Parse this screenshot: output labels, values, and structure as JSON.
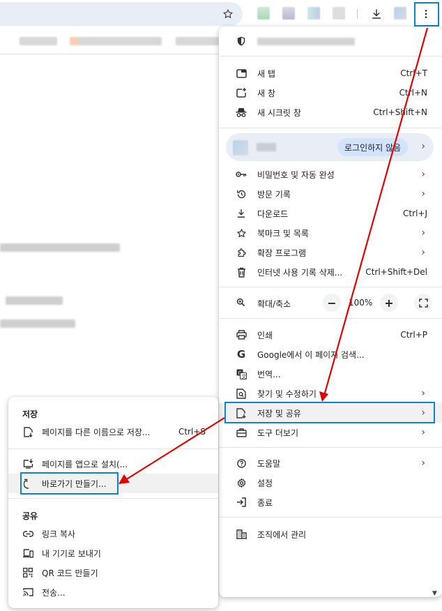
{
  "colors": {
    "highlight": "#0b84d8",
    "arrow": "#e00000",
    "signin_badge": "#d3e3fd",
    "profile_row": "#e9eef6"
  },
  "toolbar": {
    "icons": [
      "star-icon",
      "download-icon",
      "kebab-menu-icon"
    ]
  },
  "menu": {
    "profile_signin": "로그인하지 않음",
    "items": [
      {
        "label": "새 탭",
        "shortcut": "Ctrl+T",
        "icon": "new-tab-icon"
      },
      {
        "label": "새 창",
        "shortcut": "Ctrl+N",
        "icon": "new-window-icon"
      },
      {
        "label": "새 시크릿 창",
        "shortcut": "Ctrl+Shift+N",
        "icon": "incognito-icon"
      },
      {
        "label": "비밀번호 및 자동 완성",
        "shortcut": "",
        "icon": "key-icon"
      },
      {
        "label": "방문 기록",
        "shortcut": "",
        "icon": "history-icon"
      },
      {
        "label": "다운로드",
        "shortcut": "Ctrl+J",
        "icon": "download-icon"
      },
      {
        "label": "북마크 및 목록",
        "shortcut": "",
        "icon": "star-icon"
      },
      {
        "label": "확장 프로그램",
        "shortcut": "",
        "icon": "puzzle-icon"
      },
      {
        "label": "인터넷 사용 기록 삭제...",
        "shortcut": "Ctrl+Shift+Del",
        "icon": "trash-icon"
      },
      {
        "label": "인쇄",
        "shortcut": "Ctrl+P",
        "icon": "print-icon"
      },
      {
        "label": "Google에서 이 페이지 검색...",
        "shortcut": "",
        "icon": "google-icon"
      },
      {
        "label": "번역...",
        "shortcut": "",
        "icon": "translate-icon"
      },
      {
        "label": "찾기 및 수정하기",
        "shortcut": "",
        "icon": "find-icon"
      },
      {
        "label": "저장 및 공유",
        "shortcut": "",
        "icon": "save-share-icon"
      },
      {
        "label": "도구 더보기",
        "shortcut": "",
        "icon": "toolbox-icon"
      },
      {
        "label": "도움말",
        "shortcut": "",
        "icon": "help-icon"
      },
      {
        "label": "설정",
        "shortcut": "",
        "icon": "gear-icon"
      },
      {
        "label": "종료",
        "shortcut": "",
        "icon": "exit-icon"
      },
      {
        "label": "조직에서 관리",
        "shortcut": "",
        "icon": "building-icon"
      }
    ],
    "zoom": {
      "label": "확대/축소",
      "value": "100%",
      "minus": "−",
      "plus": "+"
    }
  },
  "submenu": {
    "save_heading": "저장",
    "share_heading": "공유",
    "items": [
      {
        "label": "페이지를 다른 이름으로 저장...",
        "shortcut": "Ctrl+S",
        "icon": "save-page-icon"
      },
      {
        "label": "페이지를 앱으로 설치(...",
        "shortcut": "",
        "icon": "install-app-icon"
      },
      {
        "label": "바로가기 만들기...",
        "shortcut": "",
        "icon": "shortcut-icon"
      },
      {
        "label": "링크 복사",
        "shortcut": "",
        "icon": "link-icon"
      },
      {
        "label": "내 기기로 보내기",
        "shortcut": "",
        "icon": "devices-icon"
      },
      {
        "label": "QR 코드 만들기",
        "shortcut": "",
        "icon": "qr-code-icon"
      },
      {
        "label": "전송...",
        "shortcut": "",
        "icon": "cast-icon"
      }
    ]
  }
}
